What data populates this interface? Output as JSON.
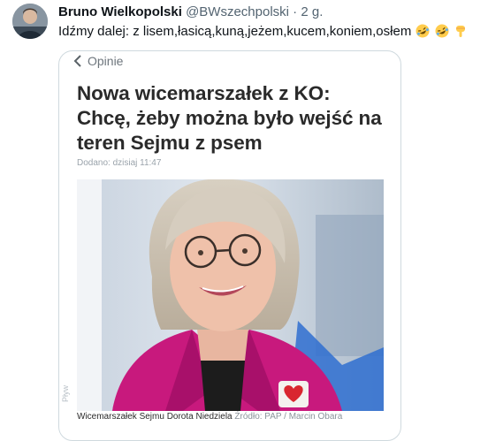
{
  "tweet": {
    "author_name": "Bruno Wielkopolski",
    "handle": "@BWszechpolski",
    "separator": "·",
    "time": "2 g.",
    "text": "Idźmy dalej: z lisem,łasicą,kuną,jeżem,kucem,koniem,osłem",
    "emojis": [
      "rolling-on-floor-laughing",
      "rolling-on-floor-laughing",
      "backhand-index-pointing-down"
    ]
  },
  "media": {
    "back_label": "Opinie",
    "headline": "Nowa wicemarszałek z KO: Chcę, żeby można było wejść na teren Sejmu z psem",
    "date": "Dodano: dzisiaj 11:47",
    "caption": "Wicemarszałek Sejmu Dorota Niedziela",
    "caption_source": "Źródło: PAP / Marcin Obara",
    "watermark": "Pływ"
  },
  "colors": {
    "text": "#0f1419",
    "secondary": "#536471",
    "headline": "#2a2a2a",
    "jacket": "#c8197d"
  }
}
